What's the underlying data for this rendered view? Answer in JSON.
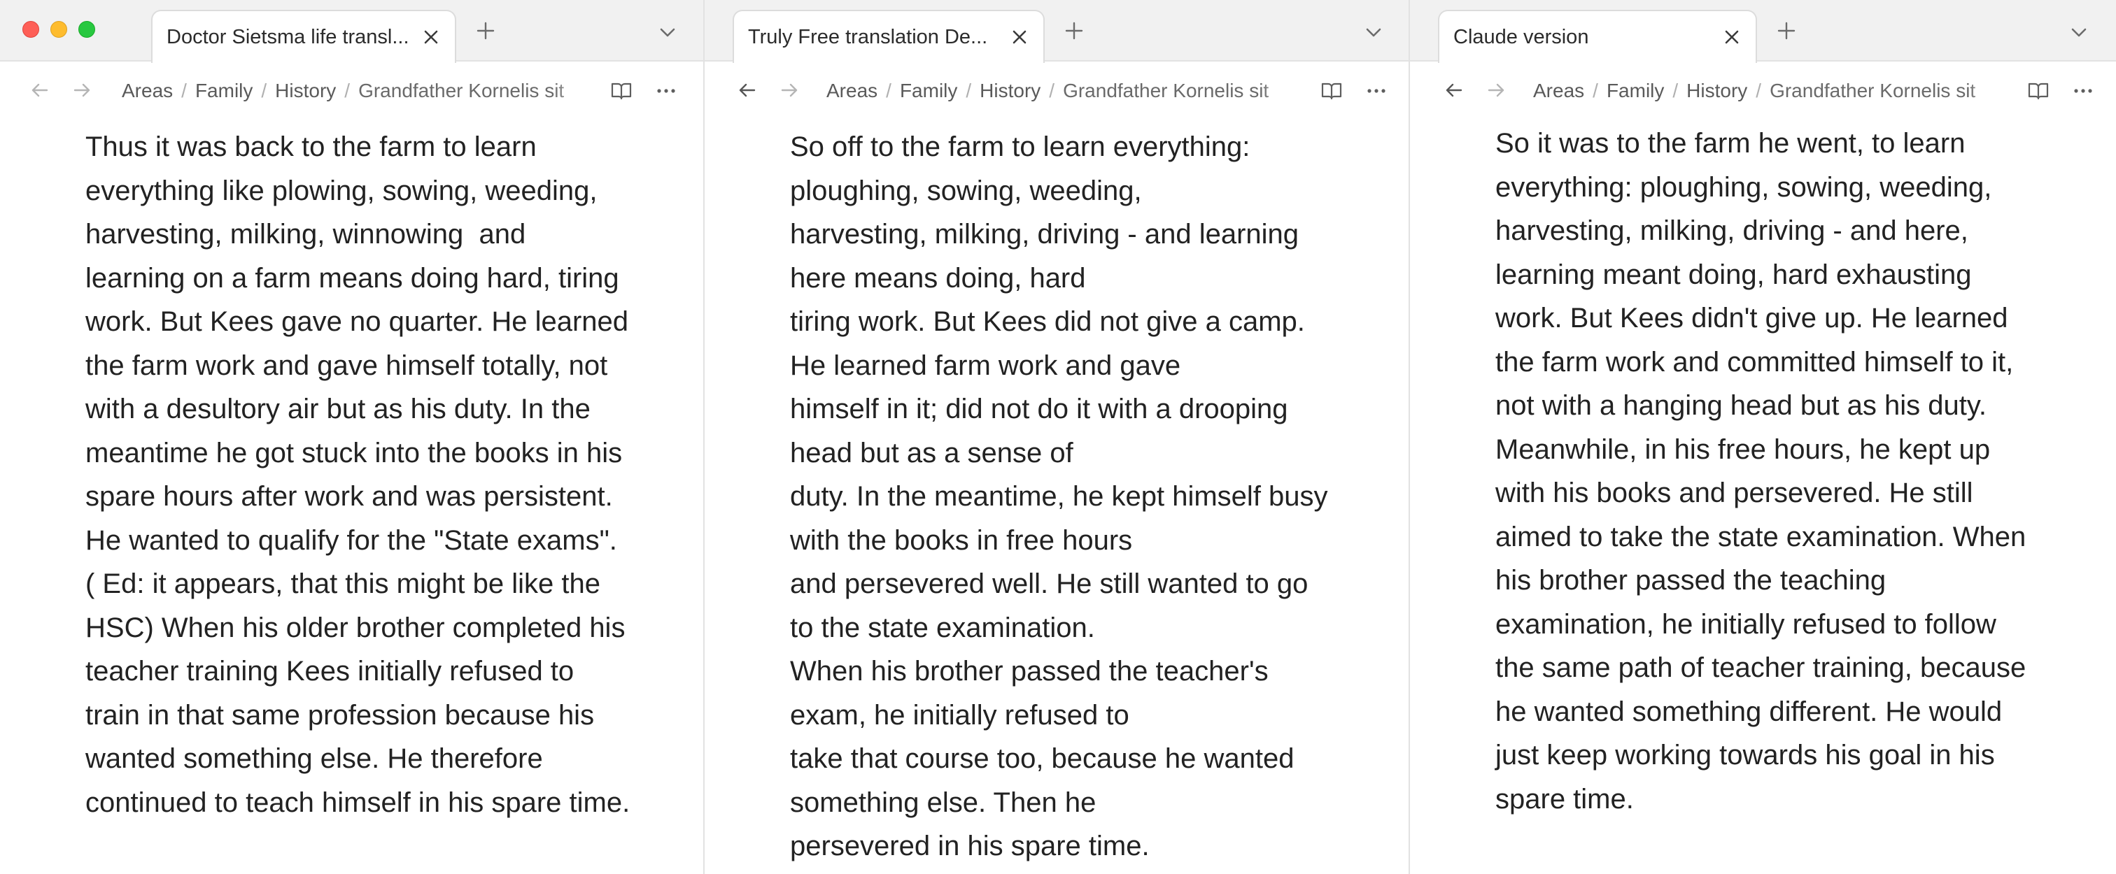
{
  "window": {
    "traffic_lights": {
      "close": "#fe5f57",
      "minimize": "#febc2e",
      "zoom": "#28c840"
    }
  },
  "icons": {
    "close": "x-icon",
    "new_tab": "plus-icon",
    "tab_list": "chevron-down-icon",
    "back": "arrow-left-icon",
    "forward": "arrow-right-icon",
    "reading_view": "book-open-icon",
    "more": "more-horizontal-icon"
  },
  "panes": [
    {
      "tab": {
        "title": "Doctor Sietsma life transl..."
      },
      "breadcrumb": [
        "Areas",
        "Family",
        "History",
        "Grandfather Kornelis sit"
      ],
      "breadcrumb_sep": "/",
      "lines": [
        "Thus it was back to the farm to learn",
        "everything like plowing, sowing, weeding,",
        "harvesting, milking, winnowing  and",
        "learning on a farm means doing hard, tiring",
        "work. But Kees gave no quarter. He learned",
        "the farm work and gave himself totally, not",
        "with a desultory air but as his duty. In the",
        "meantime he got stuck into the books in his",
        "spare hours after work and was persistent.",
        "He wanted to qualify for the \"State exams\".",
        "( Ed: it appears, that this might be like the",
        "HSC) When his older brother completed his",
        "teacher training Kees initially refused to",
        "train in that same profession because his",
        "wanted something else. He therefore",
        "continued to teach himself in his spare time."
      ]
    },
    {
      "tab": {
        "title": "Truly Free translation De..."
      },
      "breadcrumb": [
        "Areas",
        "Family",
        "History",
        "Grandfather Kornelis sit"
      ],
      "breadcrumb_sep": "/",
      "lines": [
        "So off to the farm to learn everything:",
        "ploughing, sowing, weeding,",
        "harvesting, milking, driving - and learning",
        "here means doing, hard",
        "tiring work. But Kees did not give a camp.",
        "He learned farm work and gave",
        "himself in it; did not do it with a drooping",
        "head but as a sense of",
        "duty. In the meantime, he kept himself busy",
        "with the books in free hours",
        "and persevered well. He still wanted to go",
        "to the state examination.",
        "When his brother passed the teacher's",
        "exam, he initially refused to",
        "take that course too, because he wanted",
        "something else. Then he",
        "persevered in his spare time."
      ]
    },
    {
      "tab": {
        "title": "Claude version"
      },
      "breadcrumb": [
        "Areas",
        "Family",
        "History",
        "Grandfather Kornelis sit"
      ],
      "breadcrumb_sep": "/",
      "lines": [
        "So it was to the farm he went, to learn",
        "everything: ploughing, sowing, weeding,",
        "harvesting, milking, driving - and here,",
        "learning meant doing, hard exhausting",
        "work. But Kees didn't give up. He learned",
        "the farm work and committed himself to it,",
        "not with a hanging head but as his duty.",
        "Meanwhile, in his free hours, he kept up",
        "with his books and persevered. He still",
        "aimed to take the state examination. When",
        "his brother passed the teaching",
        "examination, he initially refused to follow",
        "the same path of teacher training, because",
        "he wanted something different. He would",
        "just keep working towards his goal in his",
        "spare time."
      ]
    }
  ]
}
